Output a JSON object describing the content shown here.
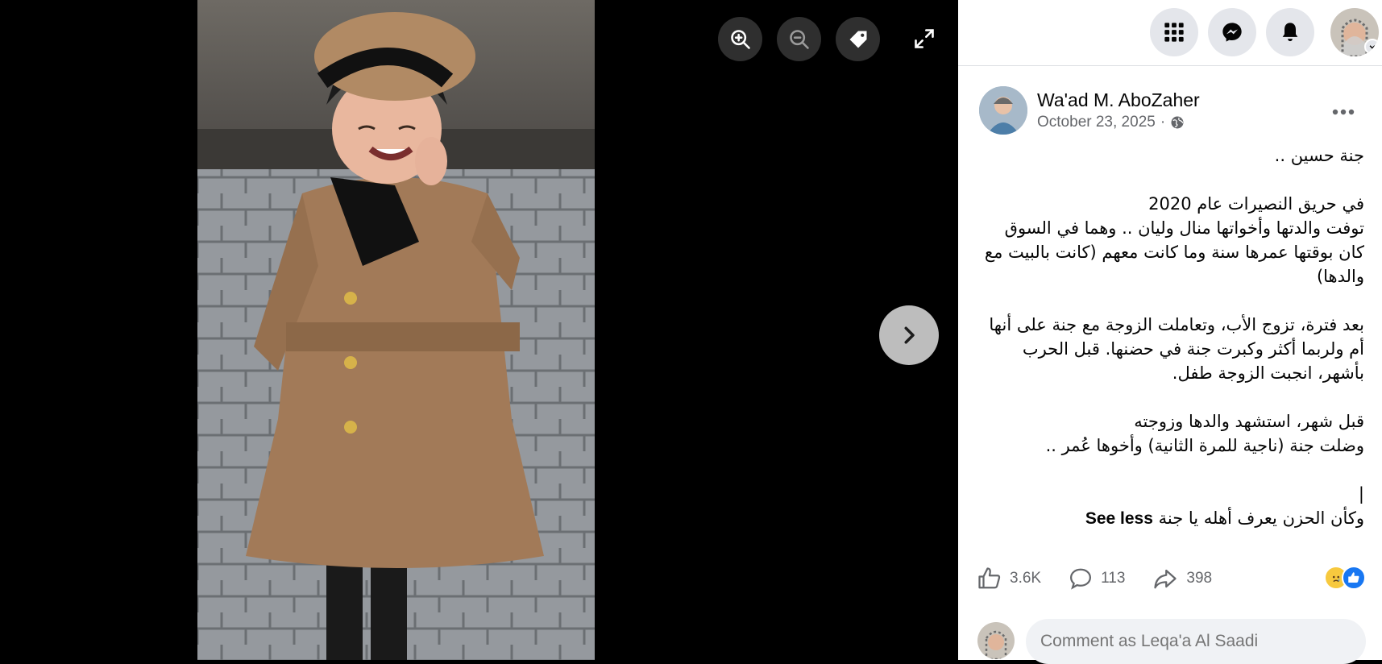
{
  "viewer": {
    "controls": {
      "zoom_in": "zoom-in-icon",
      "zoom_out": "zoom-out-icon",
      "tag": "tag-icon",
      "fullscreen": "fullscreen-icon",
      "next": "chevron-right-icon"
    }
  },
  "topbar": {
    "menu_icon": "grid-menu-icon",
    "messenger_icon": "messenger-icon",
    "notifications_icon": "bell-icon"
  },
  "post": {
    "author": "Wa'ad M. AboZaher",
    "date": "October 23, 2025",
    "date_separator": "·",
    "audience_icon": "globe-icon",
    "paragraphs": [
      [
        "جنة حسين .."
      ],
      [
        "في حريق النصيرات عام 2020",
        "توفت والدتها وأخواتها منال وليان .. وهما في السوق",
        "كان بوقتها عمرها سنة وما كانت معهم (كانت بالبيت مع والدها)"
      ],
      [
        "بعد فترة، تزوج الأب، وتعاملت الزوجة مع جنة على أنها أم ولربما أكثر وكبرت جنة في حضنها. قبل الحرب بأشهر، انجبت الزوجة طفل."
      ],
      [
        "قبل شهر، استشهد والدها وزوجته",
        "وضلت جنة (ناجية للمرة الثانية) وأخوها عُمر .."
      ]
    ],
    "cursor_line": "|",
    "last_line": "وكأن الحزن يعرف أهله يا جنة",
    "see_less": "See less",
    "likes": "3.6K",
    "comments": "113",
    "shares": "398"
  },
  "comment": {
    "placeholder": "Comment as Leqa'a Al Saadi"
  },
  "colors": {
    "accent": "#1877f2",
    "panel_bg": "#ffffff",
    "viewer_bg": "#000000",
    "secondary_text": "#65676b"
  }
}
